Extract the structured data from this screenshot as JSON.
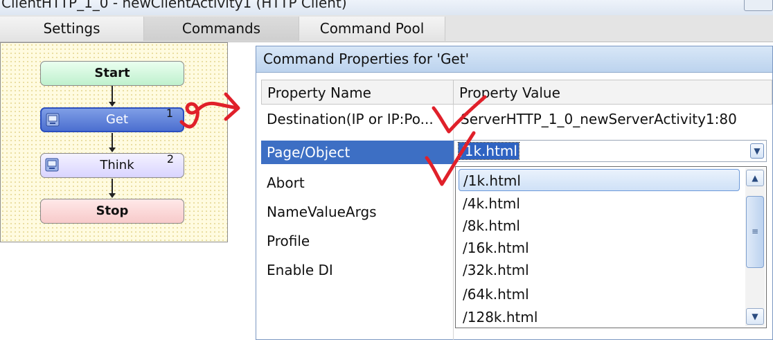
{
  "window": {
    "title": "ClientHTTP_1_0 - newClientActivity1 (HTTP Client)"
  },
  "tabs": [
    {
      "label": "Settings",
      "active": false
    },
    {
      "label": "Commands",
      "active": true
    },
    {
      "label": "Command Pool",
      "active": false
    }
  ],
  "flow": {
    "nodes": [
      {
        "label": "Start",
        "number": ""
      },
      {
        "label": "Get",
        "number": "1",
        "icon": "computer-icon"
      },
      {
        "label": "Think",
        "number": "2",
        "icon": "computer-icon"
      },
      {
        "label": "Stop",
        "number": ""
      }
    ]
  },
  "properties": {
    "title": "Command Properties for 'Get'",
    "columns": [
      "Property Name",
      "Property Value"
    ],
    "rows": [
      {
        "name": "Destination(IP or IP:Po...",
        "value": "ServerHTTP_1_0_newServerActivity1:80"
      },
      {
        "name": "Page/Object",
        "value": "/1k.html"
      },
      {
        "name": "Abort",
        "value": ""
      },
      {
        "name": "NameValueArgs",
        "value": ""
      },
      {
        "name": "Profile",
        "value": ""
      },
      {
        "name": "Enable DI",
        "value": ""
      }
    ],
    "selected_row": "Page/Object"
  },
  "combo": {
    "value": "/1k.html",
    "options": [
      "/1k.html",
      "/4k.html",
      "/8k.html",
      "/16k.html",
      "/32k.html",
      "/64k.html",
      "/128k.html"
    ],
    "highlighted": "/1k.html"
  },
  "colors": {
    "selection": "#3d6fc4",
    "annotation": "#e0202a",
    "get_node": "#4b6fd0"
  }
}
